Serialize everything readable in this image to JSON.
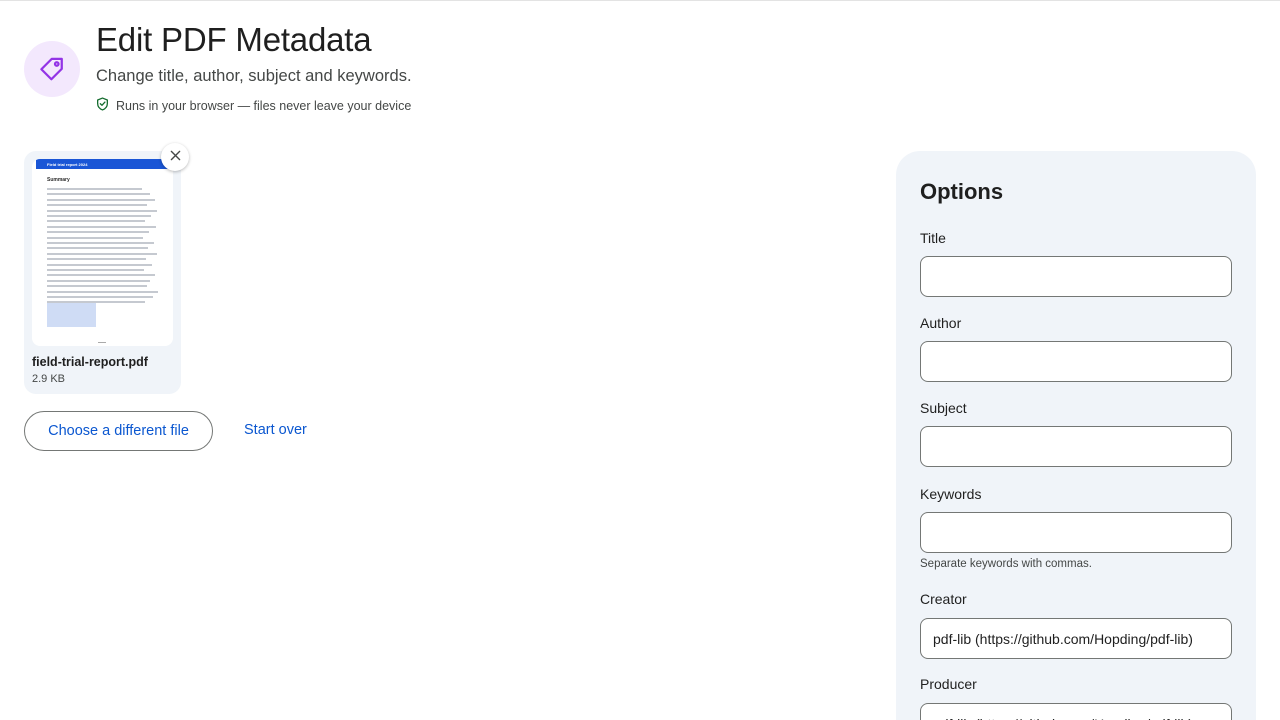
{
  "header": {
    "title": "Edit PDF Metadata",
    "subtitle": "Change title, author, subject and keywords.",
    "privacy_note": "Runs in your browser — files never leave your device",
    "icon": "tag-icon",
    "accent_color": "#9334e6"
  },
  "file": {
    "name": "field-trial-report.pdf",
    "size": "2.9 KB",
    "thumbnail": {
      "banner": "Field trial report 2024",
      "heading": "Summary"
    }
  },
  "actions": {
    "choose_label": "Choose a different file",
    "start_over_label": "Start over"
  },
  "options": {
    "title": "Options",
    "fields": [
      {
        "label": "Title",
        "value": ""
      },
      {
        "label": "Author",
        "value": ""
      },
      {
        "label": "Subject",
        "value": ""
      },
      {
        "label": "Keywords",
        "value": "",
        "hint": "Separate keywords with commas."
      },
      {
        "label": "Creator",
        "value": "pdf-lib (https://github.com/Hopding/pdf-lib)"
      },
      {
        "label": "Producer",
        "value": "pdf-lib (https://github.com/Hopding/pdf-lib)"
      }
    ]
  },
  "colors": {
    "link": "#0b57d0",
    "panel_bg": "#f0f4f9",
    "icon_bg": "#f3e8fd"
  }
}
